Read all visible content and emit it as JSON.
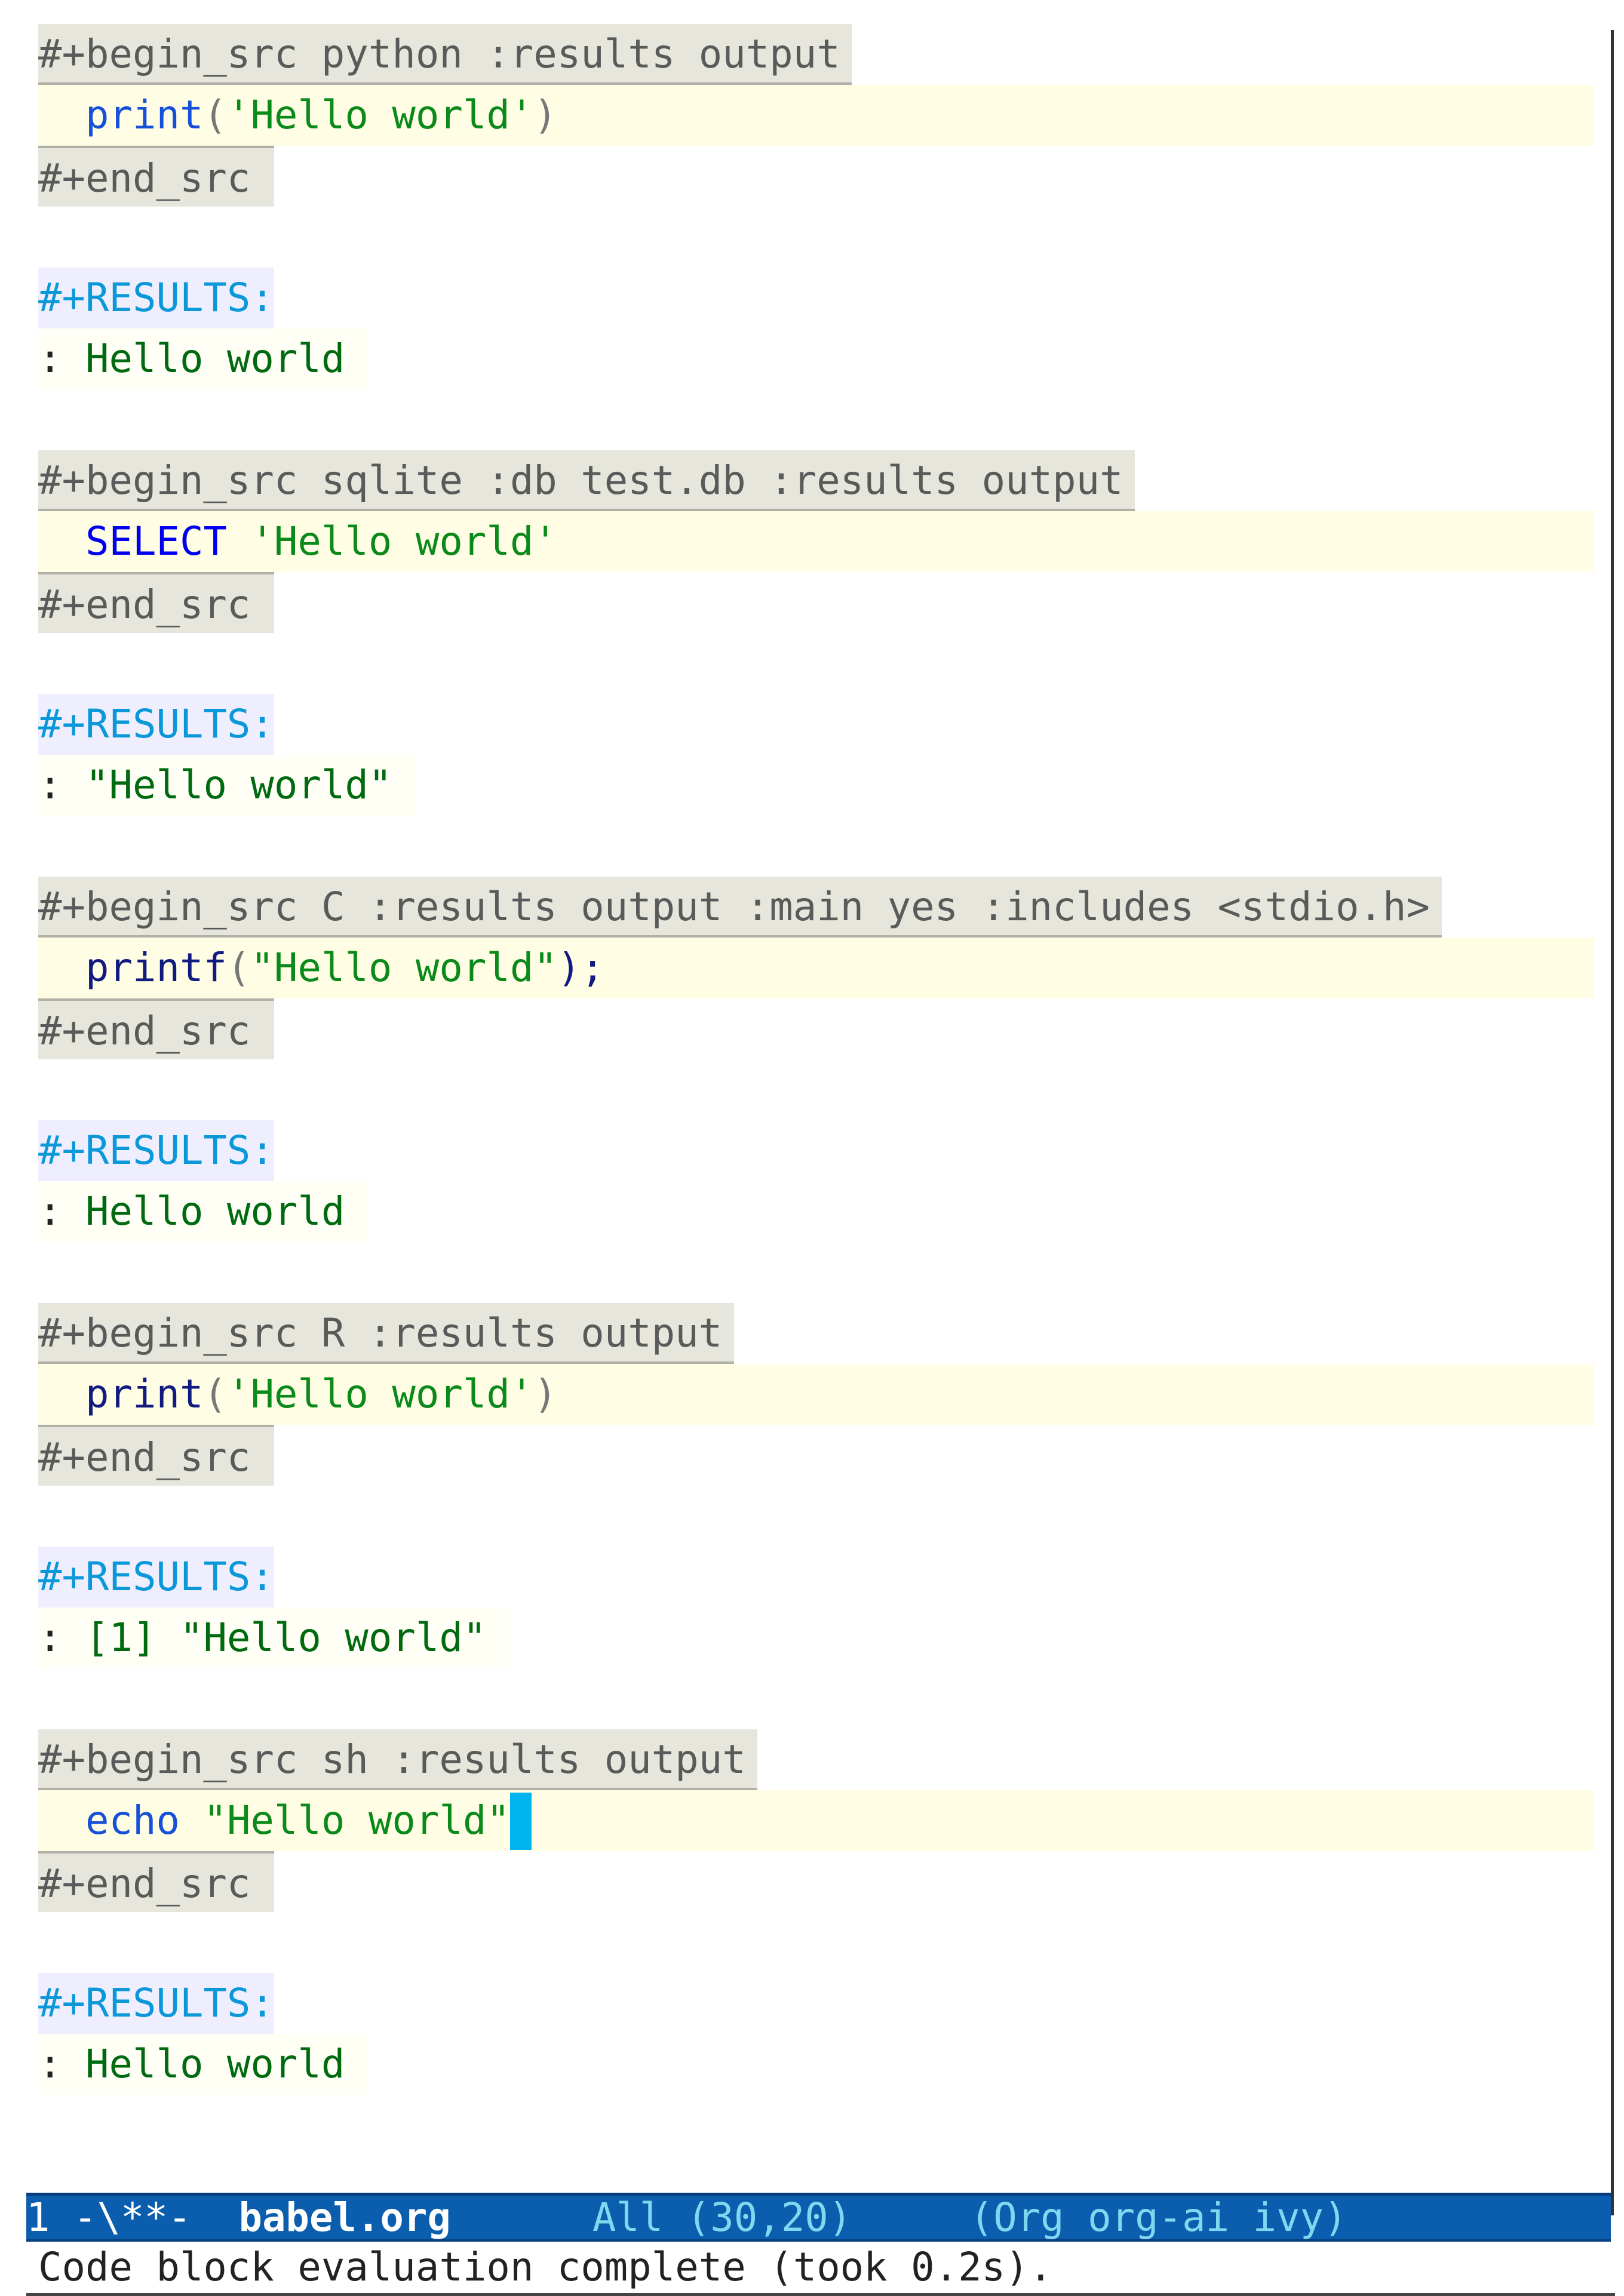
{
  "blocks": [
    {
      "header": "#+begin_src python :results output",
      "code": [
        {
          "t": "print",
          "c": "fn"
        },
        {
          "t": "(",
          "c": "punc"
        },
        {
          "t": "'Hello world'",
          "c": "str"
        },
        {
          "t": ")",
          "c": "punc"
        }
      ],
      "end": "#+end_src",
      "results_kw": "#+RESULTS:",
      "result": "Hello world"
    },
    {
      "header": "#+begin_src sqlite :db test.db :results output",
      "code": [
        {
          "t": "SELECT",
          "c": "kw"
        },
        {
          "t": " ",
          "c": ""
        },
        {
          "t": "'Hello world'",
          "c": "str"
        }
      ],
      "end": "#+end_src",
      "results_kw": "#+RESULTS:",
      "result": "\"Hello world\""
    },
    {
      "header": "#+begin_src C :results output :main yes :includes <stdio.h>",
      "code": [
        {
          "t": "printf",
          "c": "fnd"
        },
        {
          "t": "(",
          "c": "punc"
        },
        {
          "t": "\"Hello world\"",
          "c": "str"
        },
        {
          "t": ");",
          "c": "punc-dark"
        }
      ],
      "end": "#+end_src",
      "results_kw": "#+RESULTS:",
      "result": "Hello world"
    },
    {
      "header": "#+begin_src R :results output",
      "code": [
        {
          "t": "print",
          "c": "fnd"
        },
        {
          "t": "(",
          "c": "punc"
        },
        {
          "t": "'Hello world'",
          "c": "str"
        },
        {
          "t": ")",
          "c": "punc"
        }
      ],
      "end": "#+end_src",
      "results_kw": "#+RESULTS:",
      "result": "[1] \"Hello world\""
    },
    {
      "header": "#+begin_src sh :results output",
      "code": [
        {
          "t": "echo",
          "c": "fn"
        },
        {
          "t": " ",
          "c": ""
        },
        {
          "t": "\"Hello world\"",
          "c": "str"
        }
      ],
      "cursor": true,
      "end": "#+end_src",
      "results_kw": "#+RESULTS:",
      "result": "Hello world"
    }
  ],
  "result_prefix": ": ",
  "modeline": {
    "window": "1",
    "status": "-\\**-",
    "buffer": "babel.org",
    "position": "All (30,20)",
    "modes": "(Org org-ai ivy)"
  },
  "echo_area": "Code block evaluation complete (took 0.2s).",
  "colors": {
    "modeline_bg": "#0a5ead",
    "cursor": "#00b4f0",
    "results_keyword": "#0a98d8",
    "string": "#0a8a1a"
  }
}
